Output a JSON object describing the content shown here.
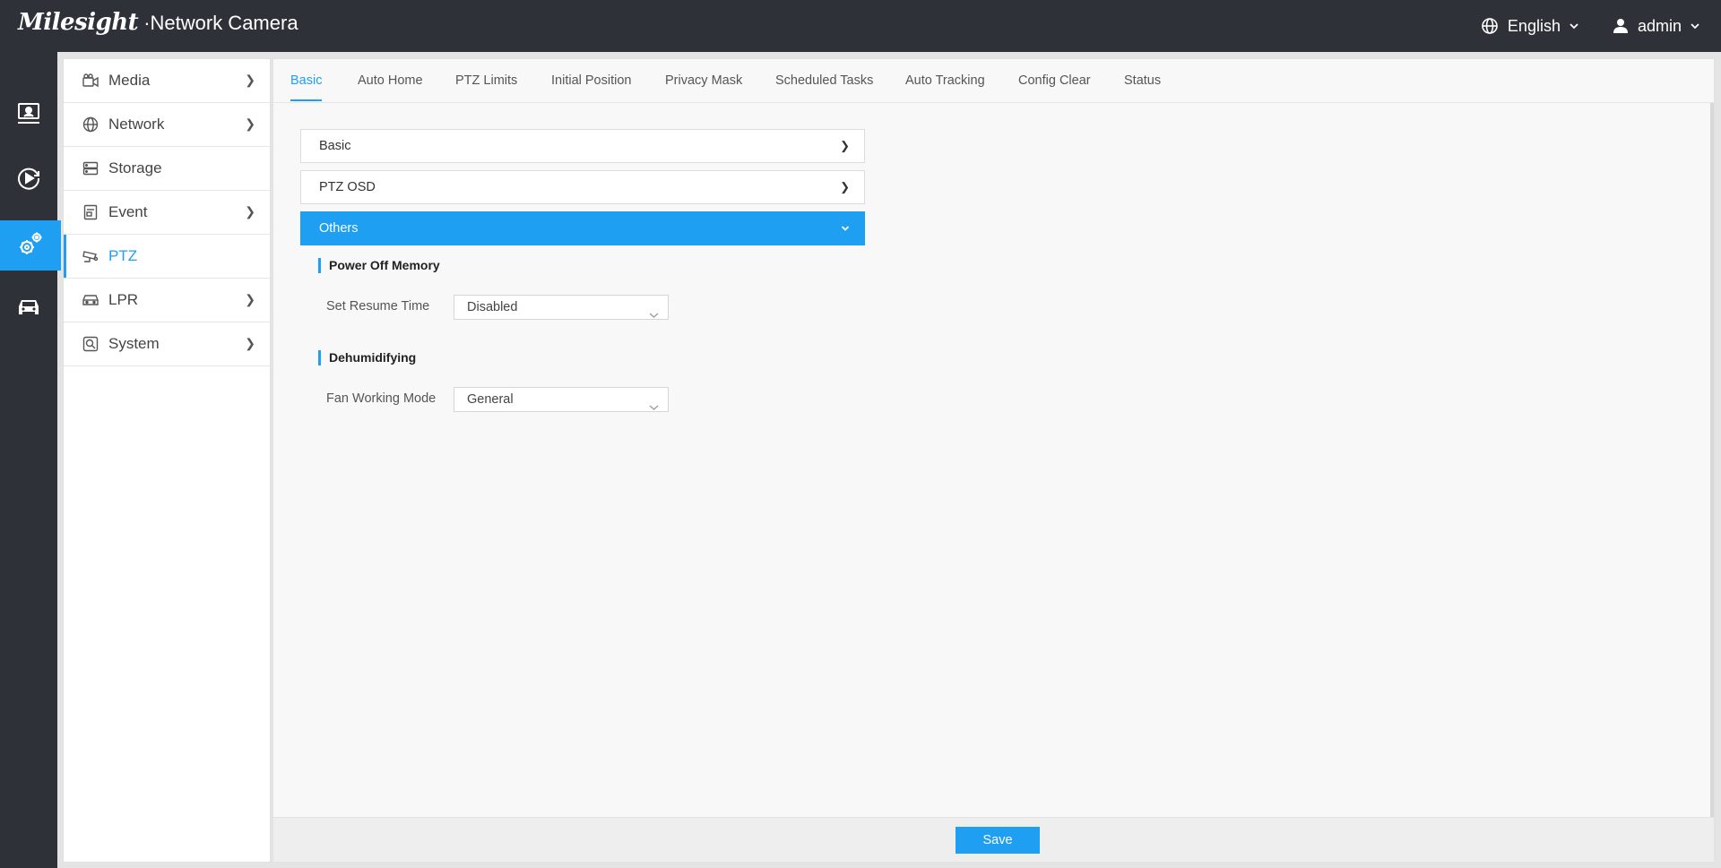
{
  "header": {
    "logo_main": "Milesight",
    "logo_sub": "·Network Camera",
    "language": "English",
    "user": "admin"
  },
  "rail": [
    {
      "icon": "live-view-icon",
      "active": false
    },
    {
      "icon": "playback-icon",
      "active": false
    },
    {
      "icon": "settings-icon",
      "active": true
    },
    {
      "icon": "vehicle-icon",
      "active": false
    }
  ],
  "sidebar": {
    "items": [
      {
        "label": "Media",
        "icon": "camera-icon",
        "has_arrow": true
      },
      {
        "label": "Network",
        "icon": "globe-icon",
        "has_arrow": true
      },
      {
        "label": "Storage",
        "icon": "storage-icon",
        "has_arrow": false
      },
      {
        "label": "Event",
        "icon": "event-icon",
        "has_arrow": true
      },
      {
        "label": "PTZ",
        "icon": "ptz-icon",
        "has_arrow": false,
        "active": true
      },
      {
        "label": "LPR",
        "icon": "car-icon",
        "has_arrow": true
      },
      {
        "label": "System",
        "icon": "system-icon",
        "has_arrow": true
      }
    ]
  },
  "tabs": [
    "Basic",
    "Auto Home",
    "PTZ Limits",
    "Initial Position",
    "Privacy Mask",
    "Scheduled Tasks",
    "Auto Tracking",
    "Config Clear",
    "Status"
  ],
  "active_tab": "Basic",
  "accordion": {
    "basic": "Basic",
    "ptz_osd": "PTZ OSD",
    "others": "Others"
  },
  "power_off_memory": {
    "title": "Power Off Memory",
    "resume_label": "Set Resume Time",
    "resume_value": "Disabled"
  },
  "dehumidifying": {
    "title": "Dehumidifying",
    "fan_label": "Fan Working Mode",
    "fan_value": "General"
  },
  "footer": {
    "save_label": "Save"
  },
  "colors": {
    "accent": "#1e9ff2",
    "header_bg": "#2e3138"
  }
}
